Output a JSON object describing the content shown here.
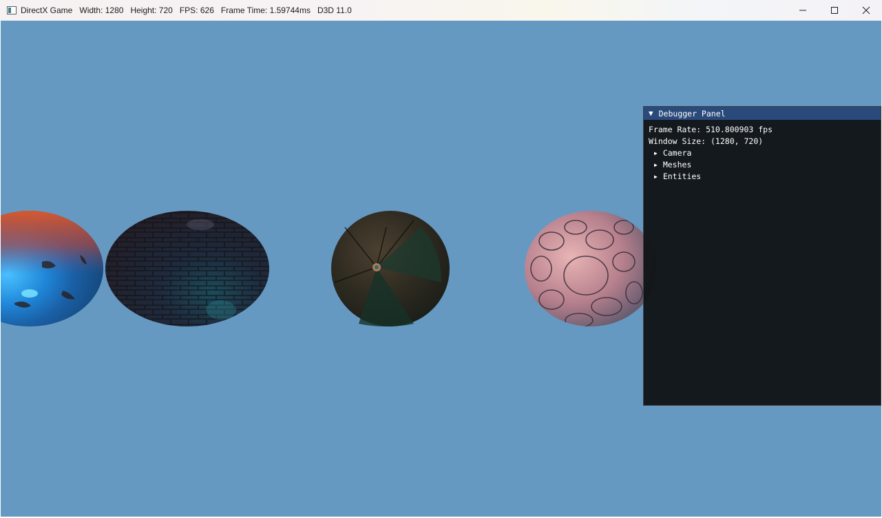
{
  "titlebar": {
    "app_title": "DirectX Game",
    "width_text": "Width: 1280",
    "height_text": "Height: 720",
    "fps_text": "FPS: 626",
    "frame_time_text": "Frame Time: 1.59744ms",
    "api_text": "D3D 11.0",
    "icons": [
      "app-window-icon",
      "minimize-icon",
      "maximize-icon",
      "close-icon"
    ]
  },
  "viewport": {
    "clear_color": "#6699c2",
    "spheres": [
      {
        "name": "lava-sphere",
        "material": "lava texture, orange/blue"
      },
      {
        "name": "cobblestone-sphere",
        "material": "dark cobblestone"
      },
      {
        "name": "leather-sphere",
        "material": "dark leather, green/brown"
      },
      {
        "name": "pebble-sphere",
        "material": "pink pebbles"
      }
    ]
  },
  "debugger": {
    "title": "Debugger Panel",
    "collapse_glyph": "▼",
    "frame_rate": "Frame Rate: 510.800903 fps",
    "window_size": "Window Size: (1280, 720)",
    "tree_glyph": "▶",
    "nodes": [
      "Camera",
      "Meshes",
      "Entities"
    ],
    "colors": {
      "header": "#294a7a",
      "background": "#111417",
      "text": "#ffffff"
    }
  }
}
